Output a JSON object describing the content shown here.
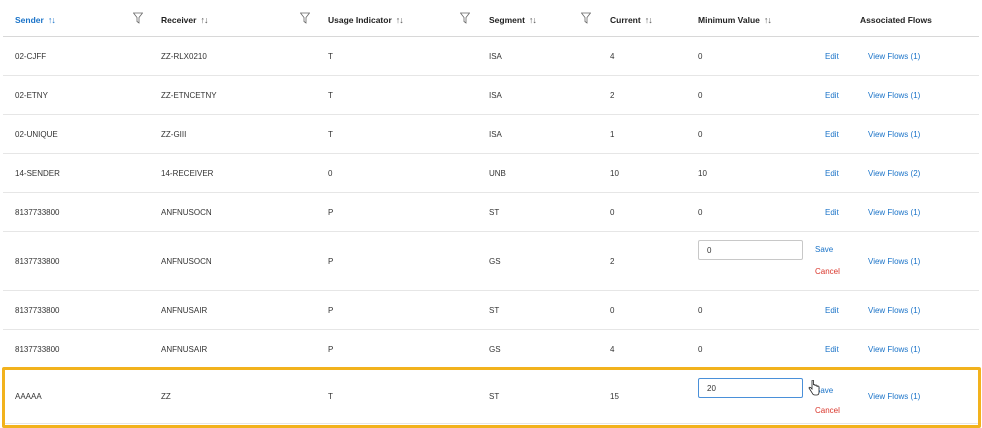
{
  "columns": [
    {
      "label": "Sender",
      "sort": "↑↓",
      "active": true
    },
    {
      "label": "Receiver",
      "sort": "↑↓"
    },
    {
      "label": "Usage Indicator",
      "sort": "↑↓"
    },
    {
      "label": "Segment",
      "sort": "↑↓"
    },
    {
      "label": "Current",
      "sort": "↑↓"
    },
    {
      "label": "Minimum Value",
      "sort": "↑↓"
    },
    {
      "label": "Associated Flows",
      "sort": ""
    }
  ],
  "rows": [
    {
      "sender": "02-CJFF",
      "receiver": "ZZ-RLX0210",
      "usage": "T",
      "segment": "ISA",
      "current": "4",
      "min": "0",
      "action": "Edit",
      "flows": "View Flows (1)"
    },
    {
      "sender": "02-ETNY",
      "receiver": "ZZ-ETNCETNY",
      "usage": "T",
      "segment": "ISA",
      "current": "2",
      "min": "0",
      "action": "Edit",
      "flows": "View Flows (1)"
    },
    {
      "sender": "02-UNIQUE",
      "receiver": "ZZ-GIII",
      "usage": "T",
      "segment": "ISA",
      "current": "1",
      "min": "0",
      "action": "Edit",
      "flows": "View Flows (1)"
    },
    {
      "sender": "14-SENDER",
      "receiver": "14-RECEIVER",
      "usage": "0",
      "segment": "UNB",
      "current": "10",
      "min": "10",
      "action": "Edit",
      "flows": "View Flows (2)"
    },
    {
      "sender": "8137733800",
      "receiver": "ANFNUSOCN",
      "usage": "P",
      "segment": "ST",
      "current": "0",
      "min": "0",
      "action": "Edit",
      "flows": "View Flows (1)"
    },
    {
      "sender": "8137733800",
      "receiver": "ANFNUSOCN",
      "usage": "P",
      "segment": "GS",
      "current": "2",
      "min": "0",
      "editing": true,
      "save": "Save",
      "cancel": "Cancel",
      "flows": "View Flows (1)"
    },
    {
      "sender": "8137733800",
      "receiver": "ANFNUSAIR",
      "usage": "P",
      "segment": "ST",
      "current": "0",
      "min": "0",
      "action": "Edit",
      "flows": "View Flows (1)"
    },
    {
      "sender": "8137733800",
      "receiver": "ANFNUSAIR",
      "usage": "P",
      "segment": "GS",
      "current": "4",
      "min": "0",
      "action": "Edit",
      "flows": "View Flows (1)"
    },
    {
      "sender": "AAAAA",
      "receiver": "ZZ",
      "usage": "T",
      "segment": "ST",
      "current": "15",
      "min": "20",
      "editing": true,
      "focused": true,
      "save": "Save",
      "cancel": "Cancel",
      "flows": "View Flows (1)"
    }
  ],
  "colors": {
    "link": "#1a73c8",
    "cancel": "#d9352a",
    "highlight": "#f2b21d",
    "focus": "#4a90d9"
  },
  "icons": {
    "filter": "filter-funnel-icon",
    "cursor": "hand-pointer-icon"
  }
}
